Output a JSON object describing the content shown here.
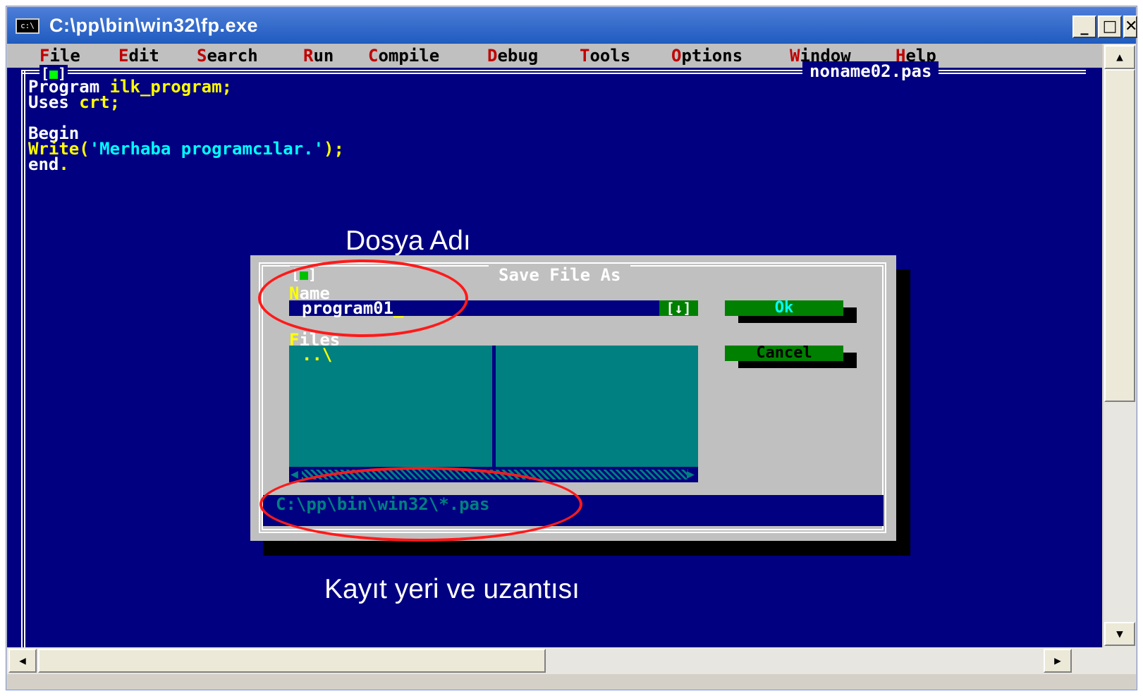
{
  "window": {
    "title": "C:\\pp\\bin\\win32\\fp.exe",
    "icon_name": "console-icon",
    "icon_text": "c:\\",
    "buttons": {
      "minimize": "_",
      "maximize": "□",
      "close": "✕"
    }
  },
  "menubar": {
    "items": [
      {
        "hot": "F",
        "rest": "ile"
      },
      {
        "hot": "E",
        "rest": "dit"
      },
      {
        "hot": "S",
        "rest": "earch"
      },
      {
        "hot": "R",
        "rest": "un"
      },
      {
        "hot": "C",
        "rest": "ompile"
      },
      {
        "hot": "D",
        "rest": "ebug"
      },
      {
        "hot": "T",
        "rest": "ools"
      },
      {
        "hot": "O",
        "rest": "ptions"
      },
      {
        "hot": "W",
        "rest": "indow"
      },
      {
        "hot": "H",
        "rest": "elp"
      }
    ]
  },
  "editor": {
    "filename": "noname02.pas",
    "code": {
      "line1_kw": "Program ",
      "line1_id": "ilk_program;",
      "line2_kw": "Uses ",
      "line2_id": "crt;",
      "line4_kw": "Begin",
      "line5_fn": "Write(",
      "line5_str": "'Merhaba programcılar.'",
      "line5_end": ");",
      "line6_kw": "end",
      "line6_dot": "."
    }
  },
  "dialog": {
    "title": "Save File As",
    "name_label_hot": "N",
    "name_label_rest": "ame",
    "name_value": "program01",
    "name_cursor": "_",
    "history_button": "[↓]",
    "files_label_hot": "F",
    "files_label_rest": "iles",
    "files_items": [
      "..\\"
    ],
    "ok_label": "Ok",
    "cancel_label": "Cancel",
    "path": "C:\\pp\\bin\\win32\\*.pas"
  },
  "annotations": {
    "top": "Dosya Adı",
    "bottom": "Kayıt yeri ve uzantısı"
  },
  "colors": {
    "console_bg": "#000080",
    "menu_bg": "#c0c0c0",
    "dialog_bg": "#c0c0c0",
    "files_bg": "#008080",
    "button_green": "#008000",
    "highlight_red": "#ff1a1a"
  }
}
